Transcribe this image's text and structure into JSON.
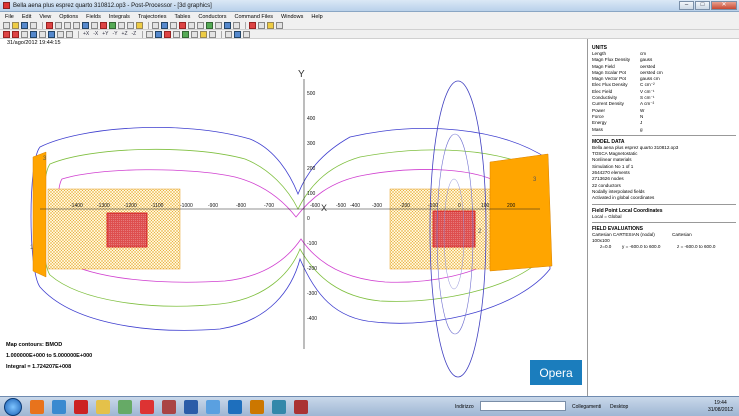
{
  "window": {
    "title": "Bella aena plus esprez quarto 310812.op3 - Post-Processor - [3d graphics]",
    "btn_min": "–",
    "btn_max": "□",
    "btn_close": "✕"
  },
  "menu": [
    "File",
    "Edit",
    "View",
    "Options",
    "Fields",
    "Integrals",
    "Trajectories",
    "Tables",
    "Conductors",
    "Command Files",
    "Windows",
    "Help"
  ],
  "toolbar2_labels": [
    "+X",
    "-X",
    "+Y",
    "-Y",
    "+Z",
    "-Z"
  ],
  "canvas": {
    "timestamp": "31/ago/2012 19:44:15",
    "axis_y_label": "Y",
    "axis_x_label": "X",
    "y_ticks": [
      "500",
      "400",
      "300",
      "200",
      "100",
      "0",
      "-100",
      "-200",
      "-300",
      "-400"
    ],
    "x_ticks": [
      "-1400",
      "-1300",
      "-1200",
      "-1100",
      "-1000",
      "-900",
      "-800",
      "-700",
      "-600",
      "-500",
      "-400",
      "-300",
      "-200",
      "-100",
      "0",
      "100",
      "200"
    ],
    "x_zero_label": "0",
    "contour_markers": [
      "3",
      "1",
      "2",
      "3"
    ],
    "map_contours_title": "Map contours: BMOD",
    "map_range": "1.000000E+000 to 5.000000E+000",
    "integral": "Integral = 1.724207E+008",
    "logo": "Opera",
    "colors": {
      "contour_blue": "#3f3fcf",
      "contour_magenta": "#d040d0",
      "contour_green": "#7fbf3f",
      "mesh_orange": "#ffa500",
      "coil_red": "#d01010"
    }
  },
  "panel": {
    "units_title": "UNITS",
    "units": [
      {
        "k": "Length",
        "v": "cm"
      },
      {
        "k": "Magn Flux Density",
        "v": "gauss"
      },
      {
        "k": "Magn Field",
        "v": "oersted"
      },
      {
        "k": "Magn Scalar Pot",
        "v": "oersted cm"
      },
      {
        "k": "Magn Vector Pot",
        "v": "gauss cm"
      },
      {
        "k": "Elec Flux Density",
        "v": "C cm⁻²"
      },
      {
        "k": "Elec Field",
        "v": "V cm⁻¹"
      },
      {
        "k": "Conductivity",
        "v": "S cm⁻¹"
      },
      {
        "k": "Current Density",
        "v": "A cm⁻²"
      },
      {
        "k": "Power",
        "v": "W"
      },
      {
        "k": "Force",
        "v": "N"
      },
      {
        "k": "Energy",
        "v": "J"
      },
      {
        "k": "Mass",
        "v": "g"
      }
    ],
    "model_title": "MODEL DATA",
    "model_lines": [
      "Bella aena plus esprez quarto 310812.op3",
      "TOSCA Magnetostatic",
      "Nonlinear materials",
      "Simulation No 1 of 1",
      "2644270 elements",
      "2713626 nodes",
      "22 conductors",
      "Nodally interpolated fields",
      "Activated in global coordinates"
    ],
    "fieldpoint_title": "Field Point Local Coordinates",
    "fieldpoint_lines": [
      "Local = Global"
    ],
    "eval_title": "FIELD EVALUATIONS",
    "eval_line1_a": "Cartesian CARTESIAN (nodal) 100x100",
    "eval_line1_b": "Cartesian",
    "eval_line2_a": "z=0.0",
    "eval_line2_b": "y = -600.0 to 600.0",
    "eval_line2_c": "z = -600.0 to 600.0"
  },
  "taskbar": {
    "address_label": "Indirizzo",
    "links_label": "Collegamenti",
    "desktop_label": "Desktop",
    "time": "19:44",
    "date": "31/08/2012"
  }
}
